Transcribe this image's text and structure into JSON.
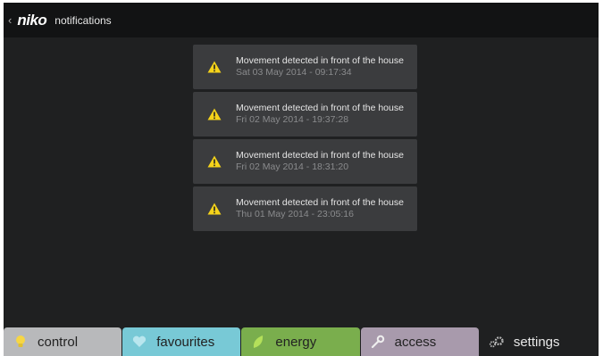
{
  "header": {
    "back_glyph": "‹",
    "logo": "niko",
    "title": "notifications"
  },
  "notifications": [
    {
      "message": "Movement detected in front of the house",
      "time": "Sat 03 May 2014 - 09:17:34",
      "icon": "warning-icon"
    },
    {
      "message": "Movement detected in front of the house",
      "time": "Fri 02 May 2014 - 19:37:28",
      "icon": "warning-icon"
    },
    {
      "message": "Movement detected in front of the house",
      "time": "Fri 02 May 2014 - 18:31:20",
      "icon": "warning-icon"
    },
    {
      "message": "Movement detected in front of the house",
      "time": "Thu 01 May 2014 - 23:05:16",
      "icon": "warning-icon"
    }
  ],
  "tabs": [
    {
      "label": "control",
      "icon": "lightbulb-icon",
      "color": "#b8b9bb"
    },
    {
      "label": "favourites",
      "icon": "heart-icon",
      "color": "#78c9d6"
    },
    {
      "label": "energy",
      "icon": "leaf-icon",
      "color": "#7aae4d"
    },
    {
      "label": "access",
      "icon": "wrench-icon",
      "color": "#a89aac"
    },
    {
      "label": "settings",
      "icon": "gears-icon",
      "color": "transparent"
    }
  ],
  "colors": {
    "background": "#1f2021",
    "header": "#121314",
    "card": "#3b3c3e",
    "warning": "#f5d31a"
  }
}
